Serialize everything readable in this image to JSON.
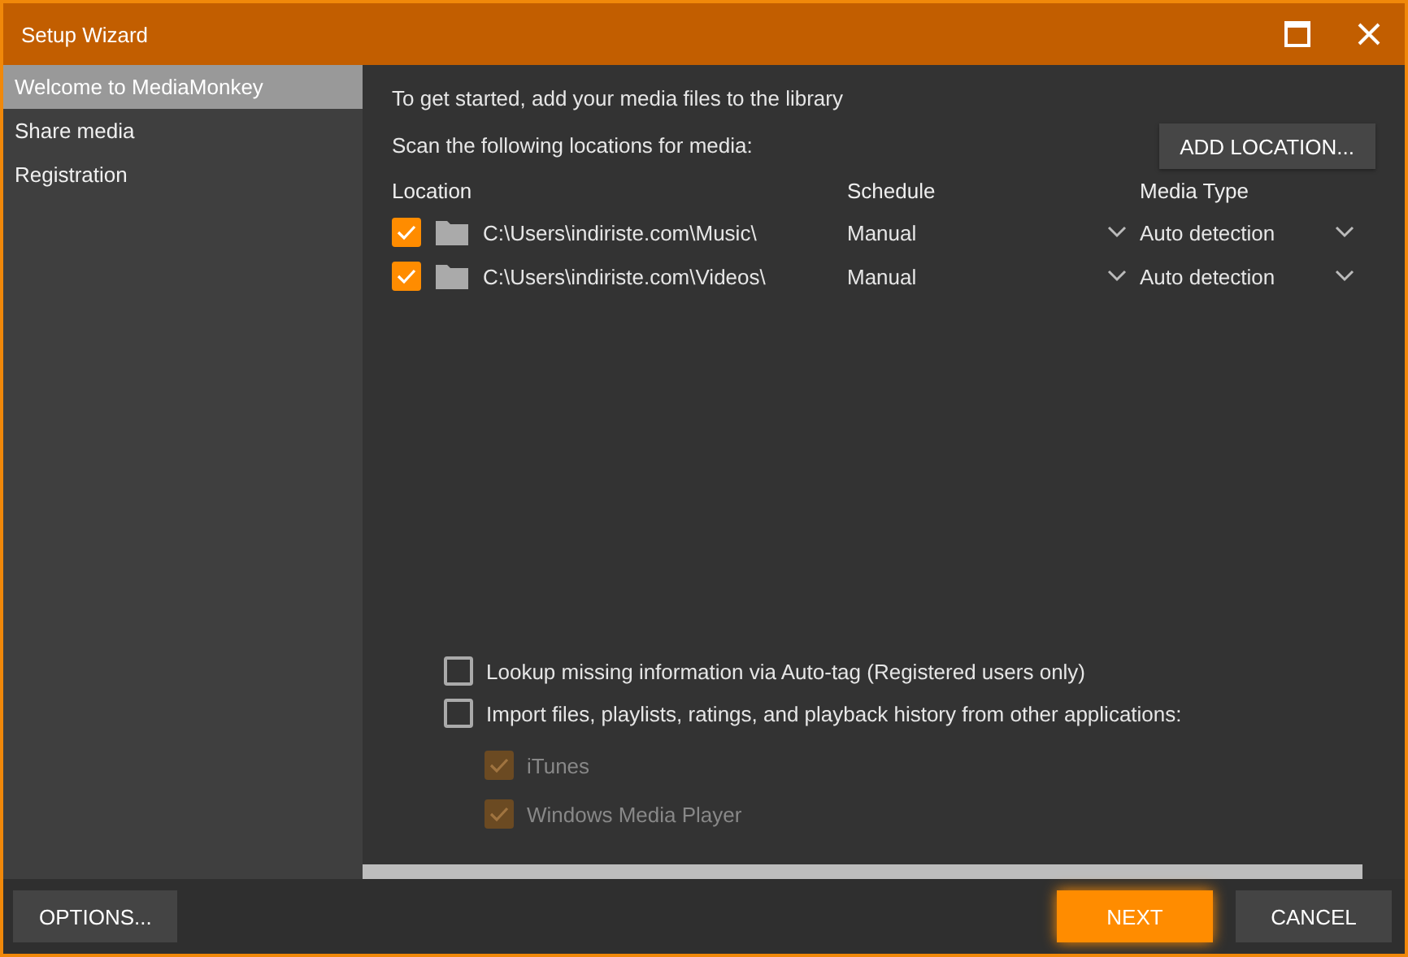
{
  "window": {
    "title": "Setup Wizard"
  },
  "sidebar": {
    "items": [
      {
        "label": "Welcome to MediaMonkey",
        "selected": true
      },
      {
        "label": "Share media",
        "selected": false
      },
      {
        "label": "Registration",
        "selected": false
      }
    ]
  },
  "intro": "To get started, add your media files to the library",
  "scan_label": "Scan the following locations for media:",
  "add_location_button": "ADD LOCATION...",
  "table": {
    "columns": [
      "Location",
      "Schedule",
      "Media Type"
    ],
    "rows": [
      {
        "checked": true,
        "location": "C:\\Users\\indiriste.com\\Music\\",
        "schedule": "Manual",
        "media_type": "Auto detection"
      },
      {
        "checked": true,
        "location": "C:\\Users\\indiriste.com\\Videos\\",
        "schedule": "Manual",
        "media_type": "Auto detection"
      }
    ]
  },
  "options": [
    {
      "label": "Lookup missing information via Auto-tag (Registered users only)",
      "checked": false
    },
    {
      "label": "Import files, playlists, ratings, and playback history from other applications:",
      "checked": false,
      "children": [
        {
          "label": "iTunes",
          "checked": true,
          "disabled": true
        },
        {
          "label": "Windows Media Player",
          "checked": true,
          "disabled": true
        }
      ]
    }
  ],
  "footer": {
    "options_button": "OPTIONS...",
    "next_button": "NEXT",
    "cancel_button": "CANCEL"
  }
}
